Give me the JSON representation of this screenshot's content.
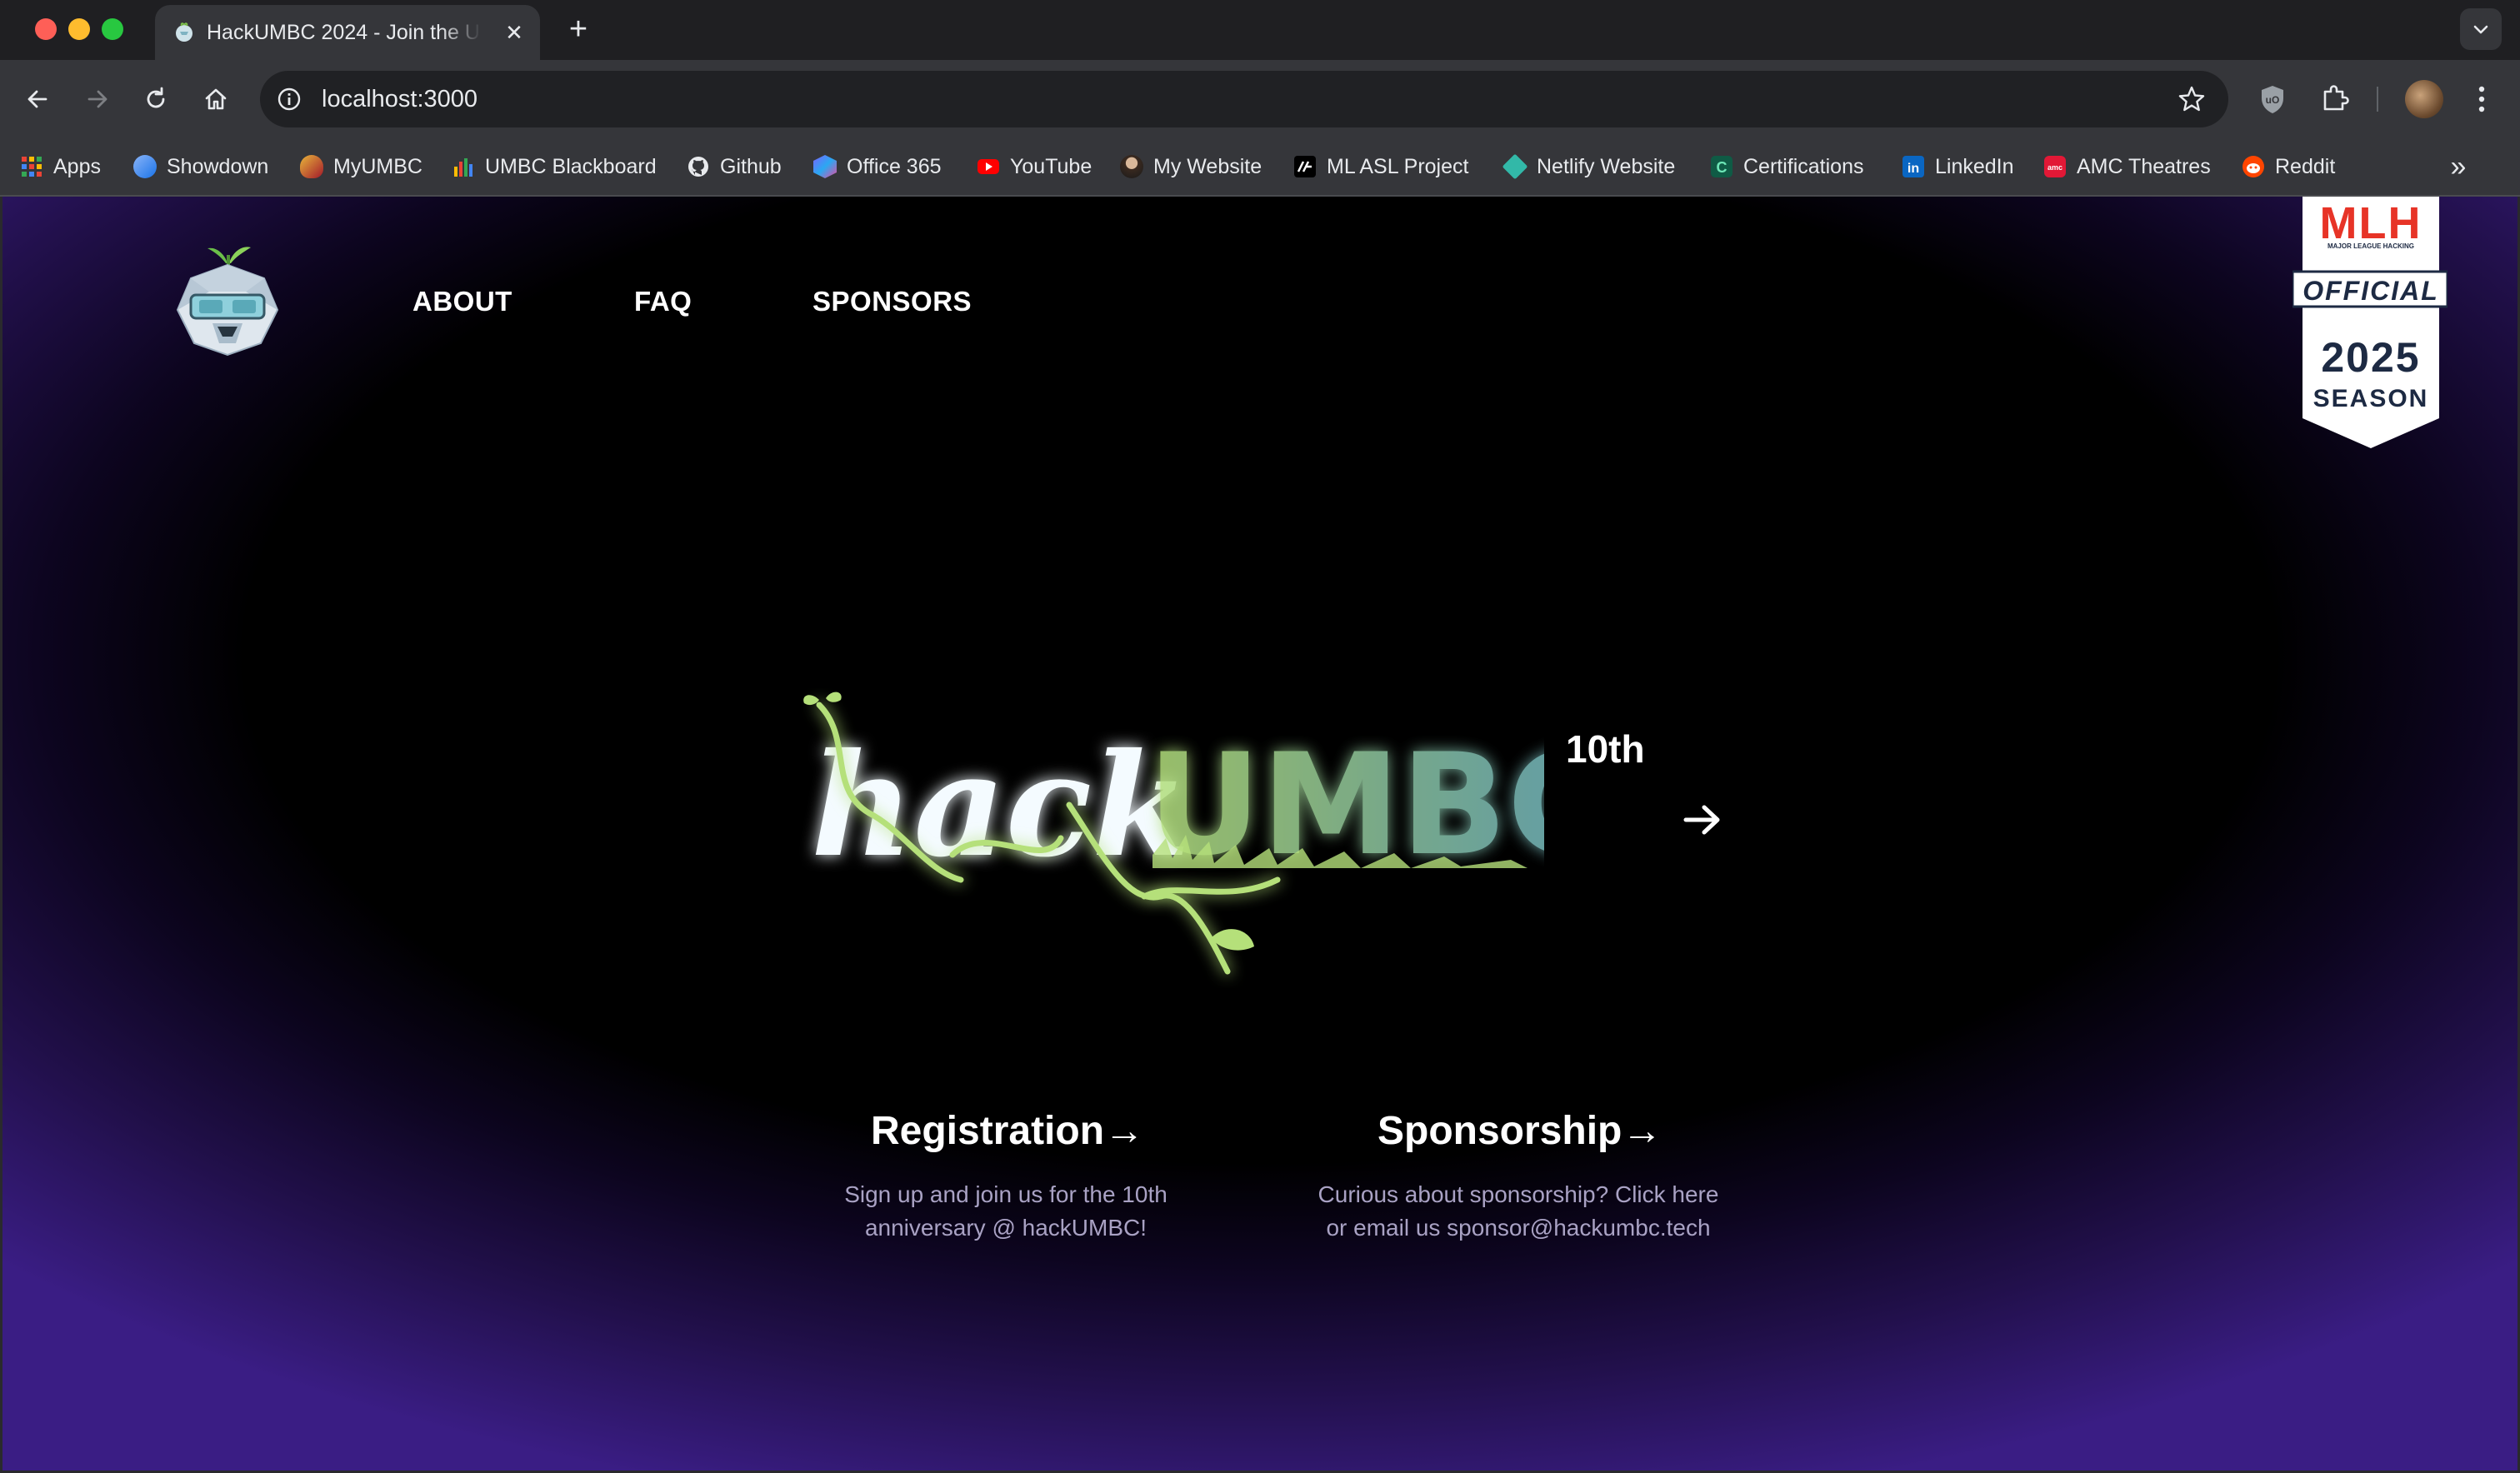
{
  "browser": {
    "tab_title": "HackUMBC 2024 - Join the U",
    "tab_close": "✕",
    "new_tab": "+",
    "url": "localhost:3000",
    "bookmarks": [
      {
        "label": "Apps",
        "icon": "apps-grid-icon"
      },
      {
        "label": "Showdown",
        "icon": "showdown-icon"
      },
      {
        "label": "MyUMBC",
        "icon": "myumbc-icon"
      },
      {
        "label": "UMBC Blackboard",
        "icon": "blackboard-icon"
      },
      {
        "label": "Github",
        "icon": "github-icon"
      },
      {
        "label": "Office 365",
        "icon": "office-icon"
      },
      {
        "label": "YouTube",
        "icon": "youtube-icon"
      },
      {
        "label": "My Website",
        "icon": "website-icon"
      },
      {
        "label": "ML ASL Project",
        "icon": "asl-icon"
      },
      {
        "label": "Netlify Website",
        "icon": "netlify-icon"
      },
      {
        "label": "Certifications",
        "icon": "certifications-icon"
      },
      {
        "label": "LinkedIn",
        "icon": "linkedin-icon"
      },
      {
        "label": "AMC Theatres",
        "icon": "amc-icon"
      },
      {
        "label": "Reddit",
        "icon": "reddit-icon"
      }
    ],
    "bookmarks_more": "»"
  },
  "site": {
    "nav": {
      "about": "ABOUT",
      "faq": "FAQ",
      "sponsors": "SPONSORS"
    },
    "mlh_badge": {
      "brand": "MLH",
      "brand_sub": "MAJOR LEAGUE HACKING",
      "official": "OFFICIAL",
      "year": "2025",
      "season": "SEASON"
    },
    "hero": {
      "logo_text_left": "hack",
      "logo_text_right": "UMBC",
      "badge": "10th"
    },
    "cards": {
      "registration": {
        "title": "Registration",
        "arrow": "→",
        "desc_line1": "Sign up and join us for the 10th",
        "desc_line2": "anniversary @ hackUMBC!"
      },
      "sponsorship": {
        "title": "Sponsorship",
        "arrow": "→",
        "desc_line1": "Curious about sponsorship? Click here",
        "desc_line2": "or email us sponsor@hackumbc.tech"
      }
    }
  },
  "colors": {
    "accent_green": "#b5e07a",
    "accent_teal": "#7fc9c9",
    "background_purple": "#3a1d84"
  }
}
